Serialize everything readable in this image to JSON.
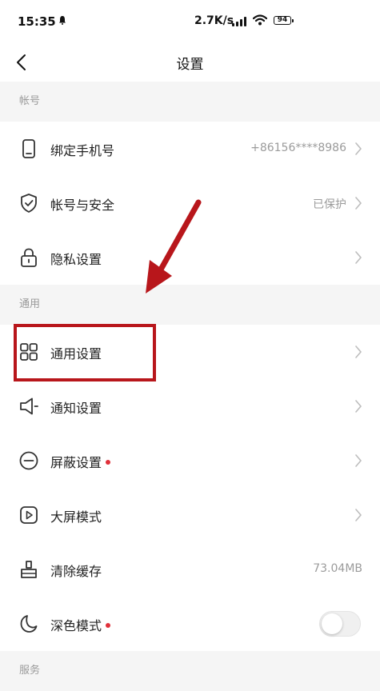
{
  "status_bar": {
    "time": "15:35",
    "net_speed": "2.7K/s",
    "battery": "94"
  },
  "nav": {
    "title": "设置"
  },
  "sections": {
    "account": "帐号",
    "general": "通用",
    "services": "服务"
  },
  "rows": {
    "bind_phone": {
      "label": "绑定手机号",
      "value": "+86156****8986",
      "icon": "phone-icon"
    },
    "account_security": {
      "label": "帐号与安全",
      "value": "已保护",
      "icon": "shield-icon"
    },
    "privacy": {
      "label": "隐私设置",
      "icon": "lock-icon"
    },
    "general_settings": {
      "label": "通用设置",
      "icon": "grid-icon"
    },
    "notifications": {
      "label": "通知设置",
      "icon": "speaker-icon"
    },
    "blocking": {
      "label": "屏蔽设置",
      "icon": "minus-circle-icon"
    },
    "big_screen": {
      "label": "大屏模式",
      "icon": "play-icon"
    },
    "clear_cache": {
      "label": "清除缓存",
      "value": "73.04MB",
      "icon": "brush-icon"
    },
    "dark_mode": {
      "label": "深色模式",
      "icon": "moon-icon",
      "enabled": false
    }
  },
  "colors": {
    "annotation_red": "#b8161b",
    "badge_red": "#e0303a"
  }
}
